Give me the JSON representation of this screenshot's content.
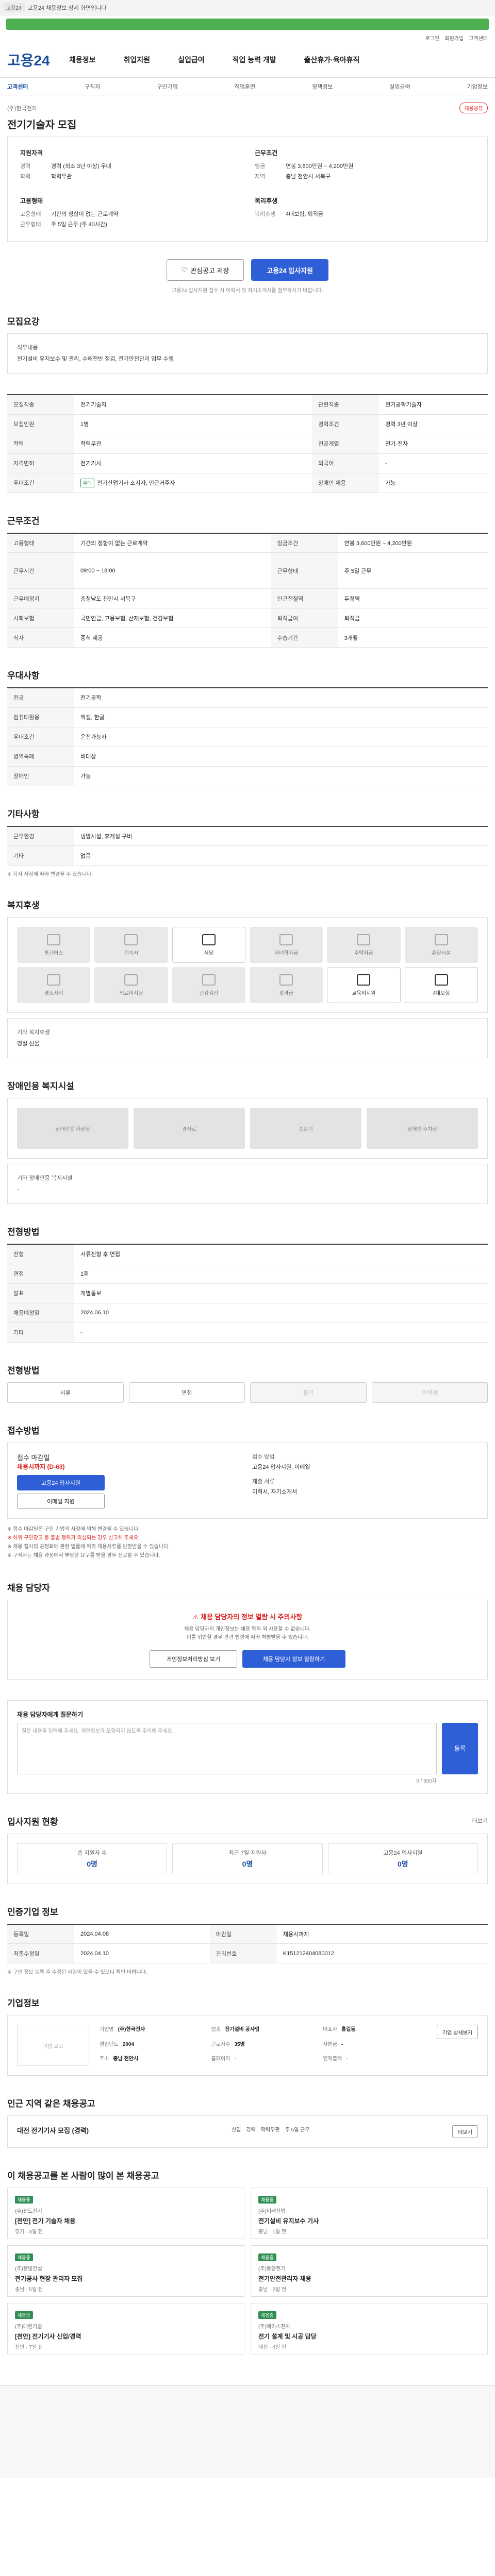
{
  "topbar": {
    "badge": "고용24",
    "text": "고용24 채용정보 상세 화면입니다"
  },
  "util": [
    "로그인",
    "회원가입",
    "고객센터"
  ],
  "header": {
    "logo": "고용24",
    "nav": [
      "채용정보",
      "취업지원",
      "실업급여",
      "직업 능력 개발",
      "출산휴가·육아휴직"
    ]
  },
  "subnav": [
    "고객센터",
    "구직자",
    "구인기업",
    "직업훈련",
    "정책정보",
    "실업급여",
    "기업정보"
  ],
  "title": {
    "company": "(주)한국전자",
    "share": "채용공유",
    "heading": "전기기술자 모집"
  },
  "summary": {
    "req_title": "지원자격",
    "req": [
      [
        "경력",
        "경력 (최소 3년 이상) 우대"
      ],
      [
        "학력",
        "학력무관"
      ]
    ],
    "cond_title": "근무조건",
    "cond": [
      [
        "임금",
        "연봉 3,600만원 ~ 4,200만원"
      ],
      [
        "지역",
        "충남 천안시 서북구"
      ]
    ],
    "form_title": "고용형태",
    "form": [
      [
        "고용형태",
        "기간의 정함이 없는 근로계약"
      ],
      [
        "근무형태",
        "주 5일 근무 (주 40시간)"
      ]
    ],
    "welfare_title": "복리후생",
    "welfare": [
      [
        "복리후생",
        "4대보험, 퇴직금"
      ]
    ]
  },
  "buttons": {
    "scrap": "관심공고 저장",
    "apply": "고용24 입사지원"
  },
  "note": "고용24 입사지원 접수 시 이력서 및 자기소개서를 첨부하시기 바랍니다.",
  "s_job": {
    "h": "모집요강",
    "lbl": "직무내용",
    "txt": "전기설비 유지보수 및 관리, 수배전반 점검, 전기안전관리 업무 수행"
  },
  "s_table": [
    [
      "모집직종",
      "전기기술자",
      "관련직종",
      "전기공학기술자"
    ],
    [
      "모집인원",
      "1명",
      "경력조건",
      "경력 3년 이상"
    ],
    [
      "학력",
      "학력무관",
      "전공계열",
      "전기·전자"
    ],
    [
      "자격면허",
      "전기기사",
      "외국어",
      "-"
    ],
    [
      "우대조건",
      "전기산업기사 소지자, 인근거주자",
      "장애인 채용",
      "가능"
    ]
  ],
  "s_cond": {
    "h": "근무조건",
    "rows": [
      [
        "고용형태",
        "기간의 정함이 없는 근로계약",
        "임금조건",
        "연봉 3,600만원 ~ 4,200만원"
      ],
      [
        "근무시간",
        "09:00 ~ 18:00",
        "근무형태",
        "주 5일 근무"
      ],
      [
        "근무예정지",
        "충청남도 천안시 서북구",
        "인근전철역",
        "두정역"
      ],
      [
        "사회보험",
        "국민연금, 고용보험, 산재보험, 건강보험",
        "퇴직급여",
        "퇴직금"
      ],
      [
        "식사",
        "중식 제공",
        "수습기간",
        "3개월"
      ]
    ]
  },
  "s_etc": {
    "h": "우대사항",
    "rows": [
      [
        "전공",
        "전기공학"
      ],
      [
        "컴퓨터활용",
        "엑셀, 한글"
      ],
      [
        "우대조건",
        "운전가능자"
      ],
      [
        "병역특례",
        "비대상"
      ],
      [
        "장애인",
        "가능"
      ]
    ]
  },
  "s_other": {
    "h": "기타사항",
    "rows": [
      [
        "근무환경",
        "냉방시설, 휴게실 구비"
      ],
      [
        "기타",
        "없음"
      ]
    ],
    "memo": "※ 회사 사정에 따라 변경될 수 있습니다."
  },
  "s_welfare": {
    "h": "복지후생",
    "items": [
      "통근버스",
      "기숙사",
      "식당",
      "자녀학자금",
      "주택자금",
      "휴양시설",
      "경조사비",
      "의료비지원",
      "건강검진",
      "성과급",
      "교육비지원",
      "4대보험"
    ],
    "memo": "기타 복지후생",
    "memo_v": "명절 선물"
  },
  "s_disable": {
    "h": "장애인용 복지시설",
    "items": [
      "장애인용 화장실",
      "경사로",
      "승강기",
      "장애인 주차장"
    ],
    "memo": "기타 장애인용 복지시설",
    "memo_v": "-"
  },
  "s_cert": {
    "h": "전형방법",
    "rows": [
      [
        "전형",
        "서류전형 후 면접"
      ],
      [
        "면접",
        "1회"
      ],
      [
        "발표",
        "개별통보"
      ],
      [
        "채용예정일",
        "2024.06.10"
      ],
      [
        "기타",
        "-"
      ]
    ]
  },
  "s_steps": {
    "h": "전형방법",
    "items": [
      "서류",
      "면접",
      "필기",
      "인적성"
    ]
  },
  "s_apply": {
    "h": "접수방법",
    "period_lbl": "접수 마감일",
    "period": "채용시까지 (D-63)",
    "btn": "고용24 입사지원",
    "btn2": "이메일 지원",
    "method_lbl": "접수 방법",
    "method": "고용24 입사지원, 이메일",
    "docs_lbl": "제출 서류",
    "docs": "이력서, 자기소개서",
    "bullets": [
      "※ 접수 마감일은 구인 기업의 사정에 의해 변경될 수 있습니다.",
      "※ 허위 구인광고 등 불법 행위가 의심되는 경우 신고해 주세요.",
      "※ 채용 절차의 공정화에 관한 법률에 따라 채용서류를 반환받을 수 있습니다.",
      "※ 구직자는 채용 과정에서 부당한 요구를 받을 경우 신고할 수 있습니다."
    ]
  },
  "s_contact": {
    "h": "채용 담당자",
    "warn": "채용 담당자의 정보 열람 시 주의사항",
    "sm1": "채용 담당자의 개인정보는 채용 목적 외 사용할 수 없습니다.",
    "sm2": "이를 위반할 경우 관련 법령에 따라 처벌받을 수 있습니다.",
    "b1": "개인정보처리방침 보기",
    "b2": "채용 담당자 정보 열람하기"
  },
  "s_qna": {
    "h": "채용 담당자에게 질문하기",
    "placeholder": "질문 내용을 입력해 주세요. 개인정보가 포함되지 않도록 주의해 주세요.",
    "btn": "등록",
    "count": "0 / 500자"
  },
  "s_stats": {
    "h": "입사지원 현황",
    "more": "더보기",
    "items": [
      [
        "총 지원자 수",
        "0명"
      ],
      [
        "최근 7일 지원자",
        "0명"
      ],
      [
        "고용24 입사지원",
        "0명"
      ]
    ]
  },
  "s_reg": {
    "h": "인증기업 정보",
    "rows": [
      [
        "등록일",
        "2024.04.08",
        "마감일",
        "채용시까지"
      ],
      [
        "최종수정일",
        "2024.04.10",
        "관리번호",
        "K151212404080012"
      ]
    ],
    "memo": "※ 구인 정보 등록 후 수정된 사항이 있을 수 있으니 확인 바랍니다."
  },
  "s_company": {
    "h": "기업정보",
    "logo": "기업 로고",
    "fields": [
      [
        "기업명",
        "(주)한국전자"
      ],
      [
        "업종",
        "전기설비 공사업"
      ],
      [
        "대표자",
        "홍길동"
      ],
      [
        "설립년도",
        "2004"
      ],
      [
        "근로자수",
        "35명"
      ],
      [
        "자본금",
        "-"
      ],
      [
        "주소",
        "충남 천안시"
      ],
      [
        "홈페이지",
        "-"
      ],
      [
        "연매출액",
        "-"
      ]
    ],
    "btn": "기업 상세보기"
  },
  "s_related": {
    "h": "인근 지역 같은 채용공고",
    "title": "대전 전기기사 모집 (경력)",
    "opts": [
      "신입",
      "경력",
      "학력무관",
      "주 5일 근무"
    ],
    "more": "더보기"
  },
  "s_cards": {
    "h": "이 채용공고를 본 사람이 많이 본 채용공고",
    "items": [
      [
        "채용중",
        "(주)선도전기",
        "[천안] 전기 기술자 채용",
        "경기 · 3일 전"
      ],
      [
        "채용중",
        "(주)미래산업",
        "전기설비 유지보수 기사",
        "충남 · 1일 전"
      ],
      [
        "채용중",
        "(주)한빛건설",
        "전기공사 현장 관리자 모집",
        "충남 · 5일 전"
      ],
      [
        "채용중",
        "(주)동양전기",
        "전기안전관리자 채용",
        "충남 · 2일 전"
      ],
      [
        "채용중",
        "(주)대한기술",
        "[천안] 전기기사 신입/경력",
        "천안 · 7일 전"
      ],
      [
        "채용중",
        "(주)에이스전자",
        "전기 설계 및 시공 담당",
        "대전 · 4일 전"
      ]
    ]
  }
}
